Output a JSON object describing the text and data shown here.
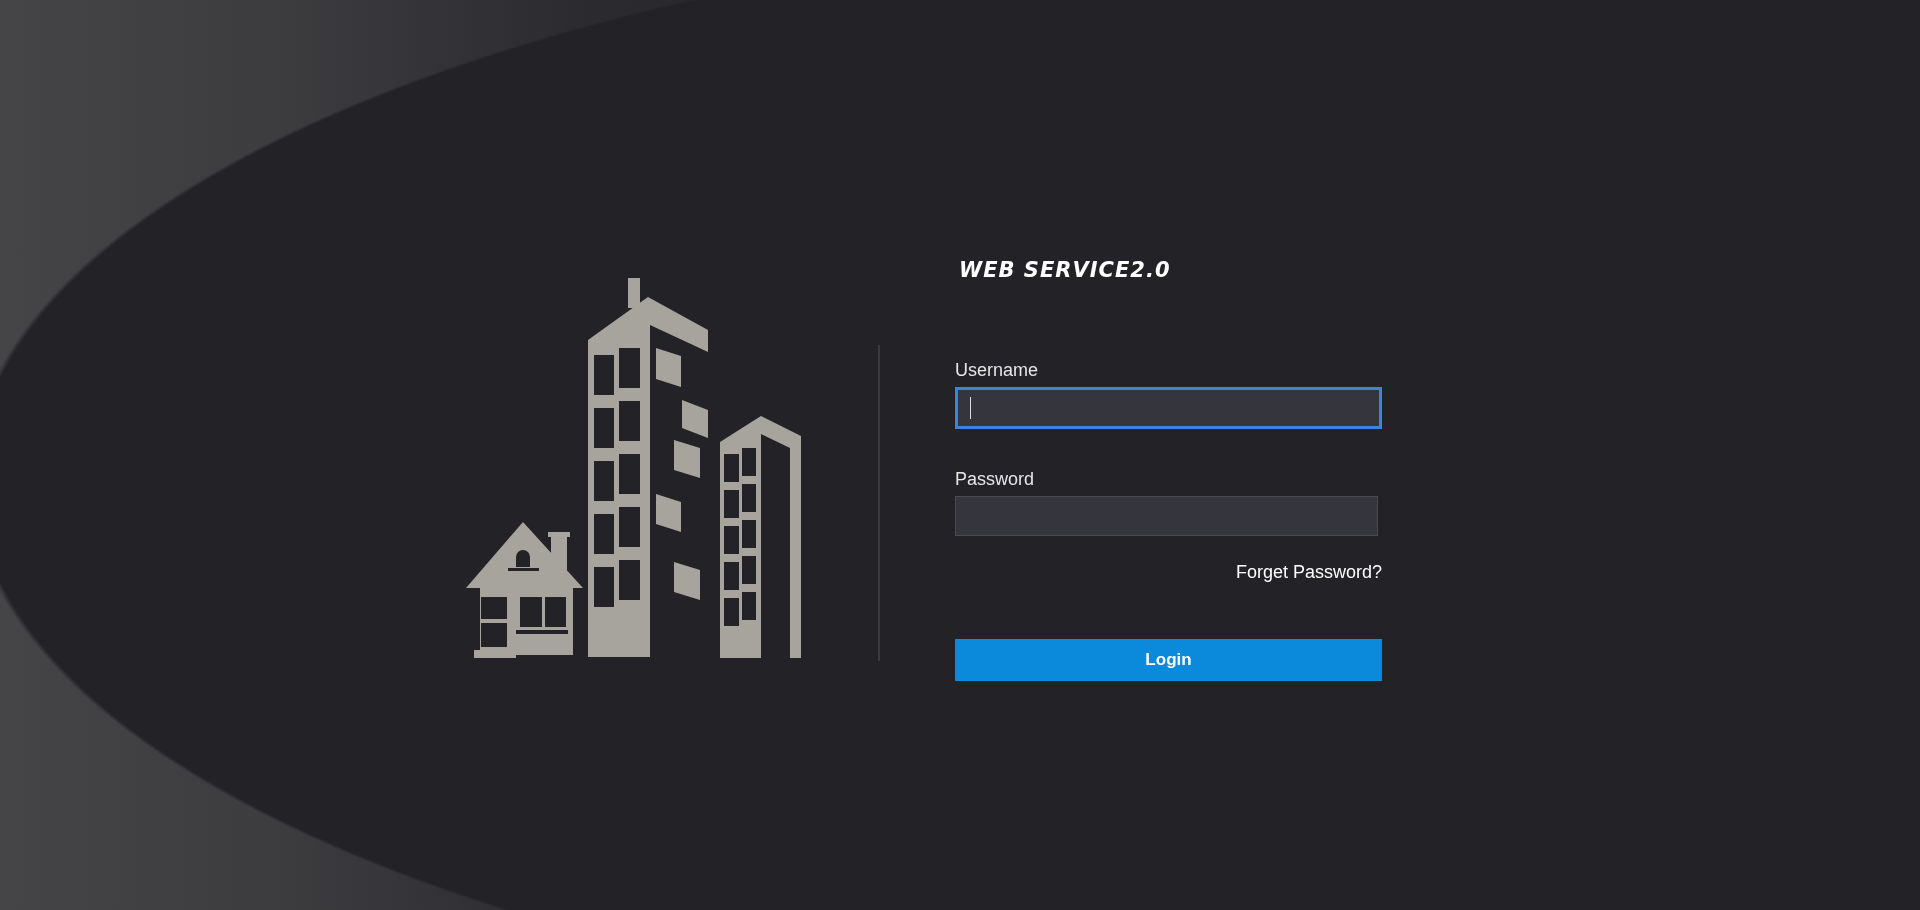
{
  "brand": {
    "title": "WEB SERVICE2.0"
  },
  "form": {
    "fields": [
      {
        "label": "Username",
        "focused": true
      },
      {
        "label": "Password",
        "focused": false
      }
    ],
    "forgot_link": "Forget Password?",
    "login_button": "Login"
  }
}
